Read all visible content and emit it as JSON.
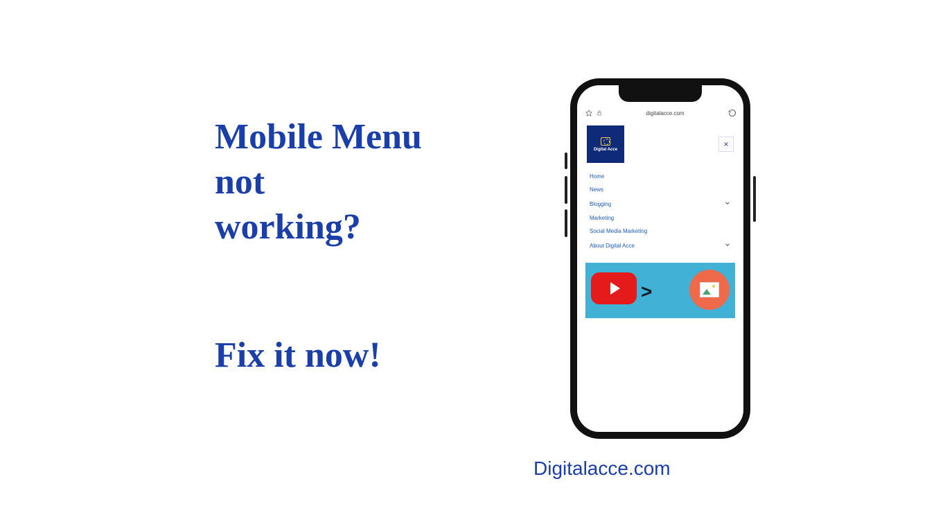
{
  "headline": {
    "line1": "Mobile Menu",
    "line2": "not",
    "line3": "working?",
    "cta": "Fix it now!"
  },
  "phone": {
    "browser": {
      "url": "digitalacce.com",
      "icons": {
        "star": "star-icon",
        "lock": "lock-icon",
        "refresh": "refresh-icon"
      }
    },
    "site": {
      "logo_text": "Digital Acce",
      "close": "×",
      "menu": [
        {
          "label": "Home",
          "has_children": false
        },
        {
          "label": "News",
          "has_children": false
        },
        {
          "label": "Blogging",
          "has_children": true
        },
        {
          "label": "Marketing",
          "has_children": false
        },
        {
          "label": "Social Media Marketing",
          "has_children": false
        },
        {
          "label": "About Digital Acce",
          "has_children": true
        }
      ]
    }
  },
  "footer_link": "Digitalacce.com"
}
